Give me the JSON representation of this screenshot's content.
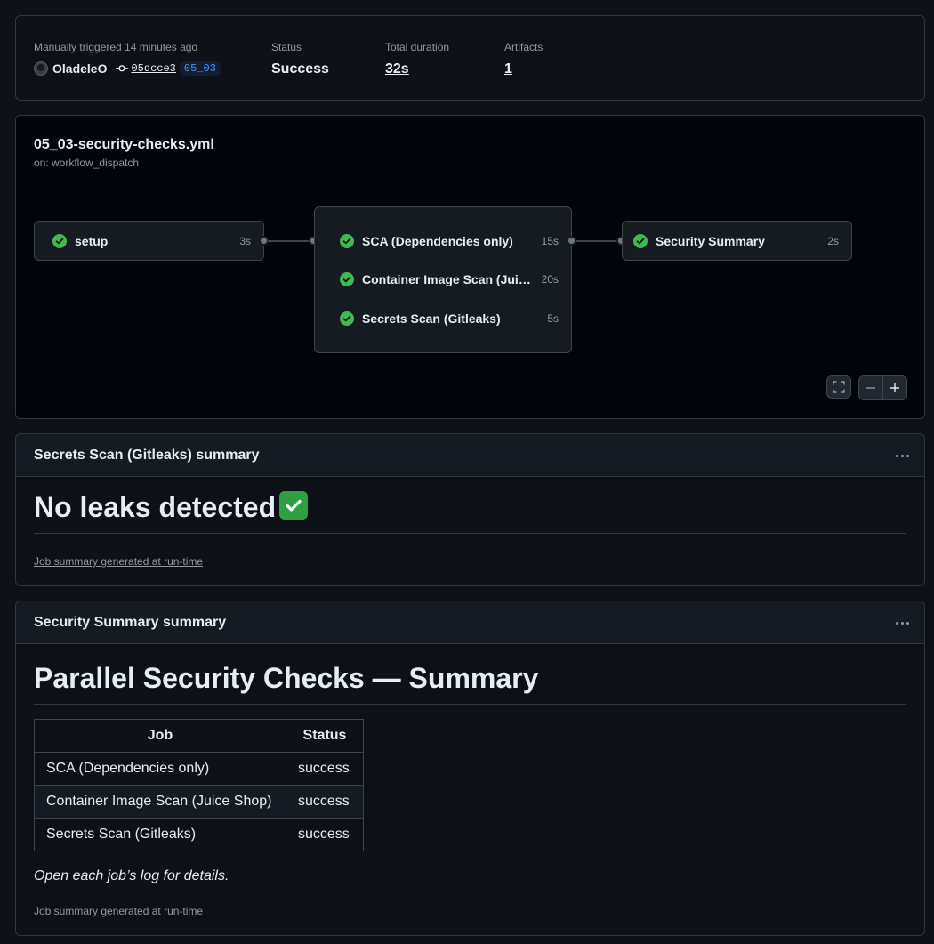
{
  "run": {
    "trigger_text": "Manually triggered 14 minutes ago",
    "actor": "OladeleO",
    "commit": "05dcce3",
    "branch": "05_03",
    "status_label": "Status",
    "status_value": "Success",
    "duration_label": "Total duration",
    "duration_value": "32s",
    "artifacts_label": "Artifacts",
    "artifacts_value": "1"
  },
  "workflow": {
    "file": "05_03-security-checks.yml",
    "trigger": "on: workflow_dispatch",
    "jobs": [
      {
        "name": "setup",
        "duration": "3s",
        "status": "success"
      },
      {
        "name": "SCA (Dependencies only)",
        "duration": "15s",
        "status": "success"
      },
      {
        "name": "Container Image Scan (Juice Shop)",
        "duration": "20s",
        "status": "success"
      },
      {
        "name": "Secrets Scan (Gitleaks)",
        "duration": "5s",
        "status": "success"
      },
      {
        "name": "Security Summary",
        "duration": "2s",
        "status": "success"
      }
    ]
  },
  "secrets_summary": {
    "header": "Secrets Scan (Gitleaks) summary",
    "heading": "No leaks detected",
    "emoji": "✅",
    "footnote": "Job summary generated at run-time"
  },
  "security_summary": {
    "header": "Security Summary summary",
    "heading": "Parallel Security Checks — Summary",
    "table_headers": [
      "Job",
      "Status"
    ],
    "rows": [
      [
        "SCA (Dependencies only)",
        "success"
      ],
      [
        "Container Image Scan (Juice Shop)",
        "success"
      ],
      [
        "Secrets Scan (Gitleaks)",
        "success"
      ]
    ],
    "note": "Open each job’s log for details.",
    "footnote": "Job summary generated at run-time"
  },
  "colors": {
    "success": "#3fb950",
    "background": "#0d1117",
    "border": "#30363d",
    "link_blue": "#4493f8"
  },
  "icons": [
    "avatar",
    "commit-icon",
    "check-circle-icon",
    "fullscreen-icon",
    "zoom-out-icon",
    "zoom-in-icon",
    "kebab-icon",
    "check-mark-emoji"
  ]
}
